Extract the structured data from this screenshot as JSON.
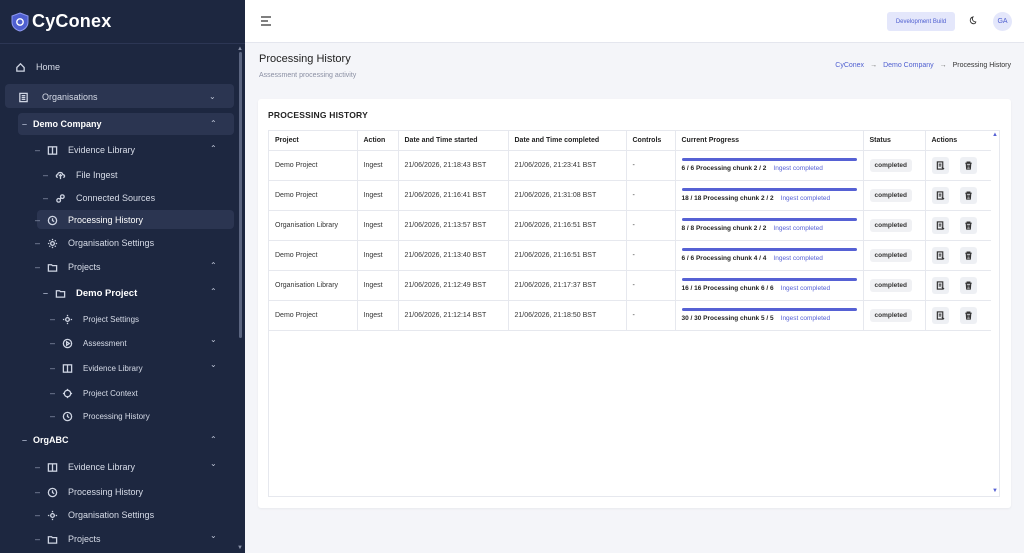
{
  "app": {
    "name": "CyConex"
  },
  "topbar": {
    "dev_build": "Development Build",
    "avatar": "GA"
  },
  "page": {
    "title": "Processing History",
    "subtitle": "Assessment processing activity"
  },
  "breadcrumb": {
    "items": [
      "CyConex",
      "Demo Company",
      "Processing History"
    ],
    "sep": "→"
  },
  "sidebar": {
    "home": "Home",
    "organisations": "Organisations",
    "demo_company": "Demo Company",
    "evidence_library": "Evidence Library",
    "file_ingest": "File Ingest",
    "connected_sources": "Connected Sources",
    "processing_history": "Processing History",
    "organisation_settings": "Organisation Settings",
    "projects": "Projects",
    "demo_project": "Demo Project",
    "project_settings": "Project Settings",
    "assessment": "Assessment",
    "project_evidence_library": "Evidence Library",
    "project_context": "Project Context",
    "project_processing_history": "Processing History",
    "orgabc": "OrgABC",
    "orgabc_evidence_library": "Evidence Library",
    "orgabc_processing_history": "Processing History",
    "orgabc_organisation_settings": "Organisation Settings",
    "orgabc_projects": "Projects",
    "dash": "–"
  },
  "table": {
    "title": "PROCESSING HISTORY",
    "headers": [
      "Project",
      "Action",
      "Date and Time started",
      "Date and Time completed",
      "Controls",
      "Current Progress",
      "Status",
      "Actions"
    ],
    "rows": [
      {
        "project": "Demo Project",
        "action": "Ingest",
        "started": "21/06/2026, 21:18:43 BST",
        "completed": "21/06/2026, 21:23:41 BST",
        "controls": "-",
        "progress_text": "6 / 6 Processing chunk 2 / 2",
        "progress_status": "Ingest completed",
        "progress": 1.0,
        "status": "completed"
      },
      {
        "project": "Demo Project",
        "action": "Ingest",
        "started": "21/06/2026, 21:16:41 BST",
        "completed": "21/06/2026, 21:31:08 BST",
        "controls": "-",
        "progress_text": "18 / 18 Processing chunk 2 / 2",
        "progress_status": "Ingest completed",
        "progress": 1.0,
        "status": "completed"
      },
      {
        "project": "Organisation Library",
        "action": "Ingest",
        "started": "21/06/2026, 21:13:57 BST",
        "completed": "21/06/2026, 21:16:51 BST",
        "controls": "-",
        "progress_text": "8 / 8 Processing chunk 2 / 2",
        "progress_status": "Ingest completed",
        "progress": 1.0,
        "status": "completed"
      },
      {
        "project": "Demo Project",
        "action": "Ingest",
        "started": "21/06/2026, 21:13:40 BST",
        "completed": "21/06/2026, 21:16:51 BST",
        "controls": "-",
        "progress_text": "6 / 6 Processing chunk 4 / 4",
        "progress_status": "Ingest completed",
        "progress": 1.0,
        "status": "completed"
      },
      {
        "project": "Organisation Library",
        "action": "Ingest",
        "started": "21/06/2026, 21:12:49 BST",
        "completed": "21/06/2026, 21:17:37 BST",
        "controls": "-",
        "progress_text": "16 / 16 Processing chunk 6 / 6",
        "progress_status": "Ingest completed",
        "progress": 1.0,
        "status": "completed"
      },
      {
        "project": "Demo Project",
        "action": "Ingest",
        "started": "21/06/2026, 21:12:14 BST",
        "completed": "21/06/2026, 21:18:50 BST",
        "controls": "-",
        "progress_text": "30 / 30 Processing chunk 5 / 5",
        "progress_status": "Ingest completed",
        "progress": 1.0,
        "status": "completed"
      }
    ]
  },
  "colors": {
    "sidebar_bg": "#1d2740",
    "accent": "#5661d4",
    "page_bg": "#f4f5f9"
  }
}
